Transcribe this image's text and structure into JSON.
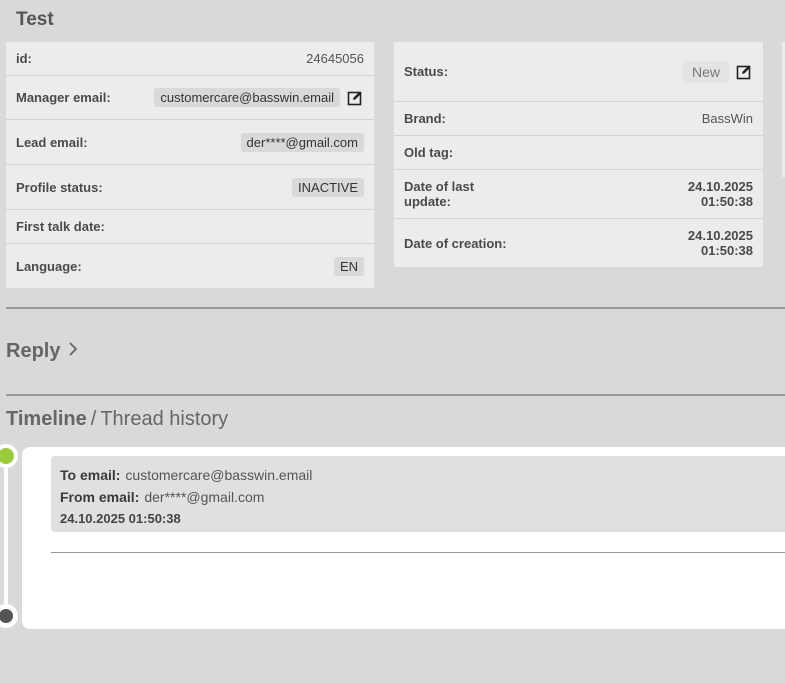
{
  "page": {
    "title": "Test"
  },
  "left_card": {
    "rows": [
      {
        "label": "id:",
        "value": "24645056"
      },
      {
        "label": "Manager email:",
        "value": "customercare@basswin.email"
      },
      {
        "label": "Lead email:",
        "value": "der****@gmail.com"
      },
      {
        "label": "Profile status:",
        "value": "INACTIVE"
      },
      {
        "label": "First talk date:",
        "value": ""
      },
      {
        "label": "Language:",
        "value": "EN"
      }
    ]
  },
  "right_card": {
    "rows": [
      {
        "label": "Status:",
        "value": "New"
      },
      {
        "label": "Brand:",
        "value": "BassWin"
      },
      {
        "label": "Old tag:",
        "value": ""
      },
      {
        "label_line1": "Date of last",
        "label_line2": "update:",
        "value_line1": "24.10.2025",
        "value_line2": "01:50:38"
      },
      {
        "label": "Date of creation:",
        "value_line1": "24.10.2025",
        "value_line2": "01:50:38"
      }
    ]
  },
  "reply": {
    "label": "Reply"
  },
  "timeline": {
    "title": "Timeline",
    "separator": "/",
    "subtitle": "Thread history",
    "messages": [
      {
        "to_label": "To email:",
        "to_value": "customercare@basswin.email",
        "from_label": "From email:",
        "from_value": "der****@gmail.com",
        "date": "24.10.2025 01:50:38"
      }
    ]
  },
  "colors": {
    "background": "#d9d9d9",
    "card": "#ececec",
    "timeline_active_dot": "#9ccb3b",
    "timeline_end_dot": "#555555"
  },
  "icons": [
    "edit-icon",
    "chevron-right-icon"
  ]
}
